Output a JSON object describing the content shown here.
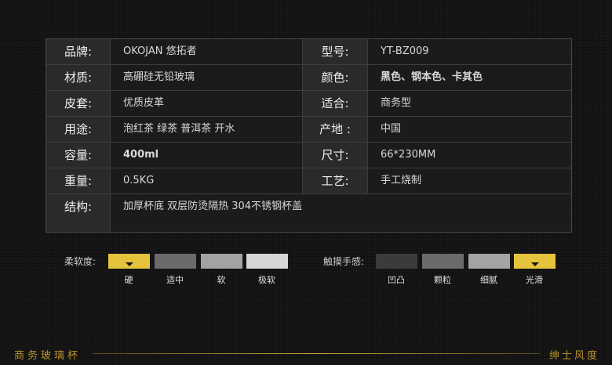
{
  "specs": {
    "rows": [
      {
        "label1": "品牌:",
        "value1": "OKOJAN 悠拓者",
        "label2": "型号:",
        "value2": "YT-BZ009"
      },
      {
        "label1": "材质:",
        "value1": "高硼硅无铅玻璃",
        "label2": "颜色:",
        "value2": "黑色、钢本色、卡其色"
      },
      {
        "label1": "皮套:",
        "value1": "优质皮革",
        "label2": "适合:",
        "value2": "商务型"
      },
      {
        "label1": "用途:",
        "value1": "泡红茶 绿茶 普洱茶 开水",
        "label2": "产地 :",
        "value2": "中国"
      },
      {
        "label1": "容量:",
        "value1": "400ml",
        "label2": "尺寸:",
        "value2": "66*230MM"
      },
      {
        "label1": "重量:",
        "value1": "0.5KG",
        "label2": "工艺:",
        "value2": "手工烧制"
      }
    ],
    "last_row": {
      "label": "结构:",
      "value": "加厚杯底 双层防烫隔热 304不锈钢杯盖"
    }
  },
  "softness": {
    "label": "柔软度:",
    "options": [
      "硬",
      "适中",
      "软",
      "极软"
    ],
    "colors": [
      "#e5c43d",
      "#6b6b6b",
      "#a3a3a3",
      "#d6d6d6"
    ],
    "selected": "硬"
  },
  "texture": {
    "label": "触摸手感:",
    "options": [
      "凹凸",
      "颗粒",
      "细腻",
      "光滑"
    ],
    "colors": [
      "#3b3b3b",
      "#6b6b6b",
      "#a3a3a3",
      "#e5c43d"
    ],
    "selected": "光滑"
  },
  "footer": {
    "left": "商务玻璃杯",
    "right": "绅士风度"
  }
}
